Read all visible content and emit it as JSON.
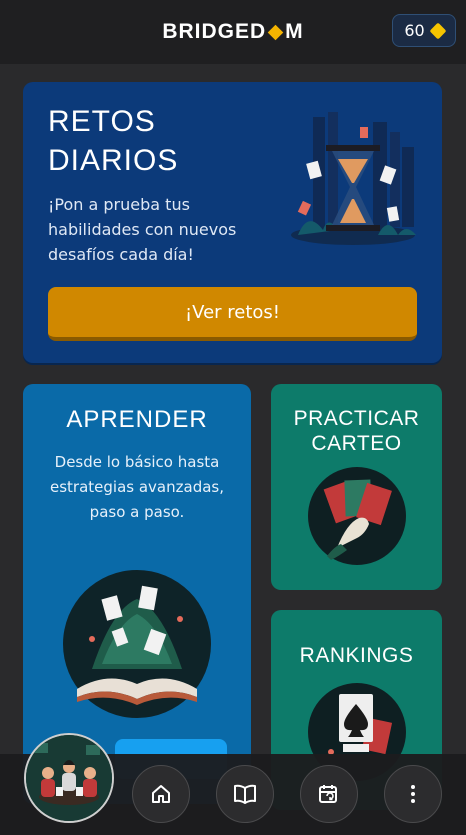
{
  "header": {
    "logo_left": "BRIDGED",
    "logo_right": "M",
    "coins": "60"
  },
  "retos": {
    "title": "RETOS DIARIOS",
    "description": "¡Pon a prueba tus habilidades con nuevos desafíos cada día!",
    "button_label": "¡Ver retos!",
    "art_icon": "hourglass-cards-icon"
  },
  "aprender": {
    "title": "APRENDER",
    "description": "Desde lo básico hasta estrategias avanzadas, paso a paso.",
    "art_icon": "open-book-cards-icon"
  },
  "practicar": {
    "title": "PRACTICAR CARTEO",
    "art_icon": "hand-cards-icon"
  },
  "rankings": {
    "title": "RANKINGS",
    "art_icon": "ace-of-spades-icon"
  },
  "nav": {
    "items": [
      {
        "icon": "home-icon"
      },
      {
        "icon": "book-icon"
      },
      {
        "icon": "calendar-refresh-icon"
      },
      {
        "icon": "more-vertical-icon"
      }
    ]
  },
  "colors": {
    "background": "#2a2a2c",
    "retos_card": "#0c3a7a",
    "retos_button": "#d08800",
    "aprender_card": "#0a6aa8",
    "green_card": "#0d7b6a",
    "coin": "#f5c400"
  }
}
